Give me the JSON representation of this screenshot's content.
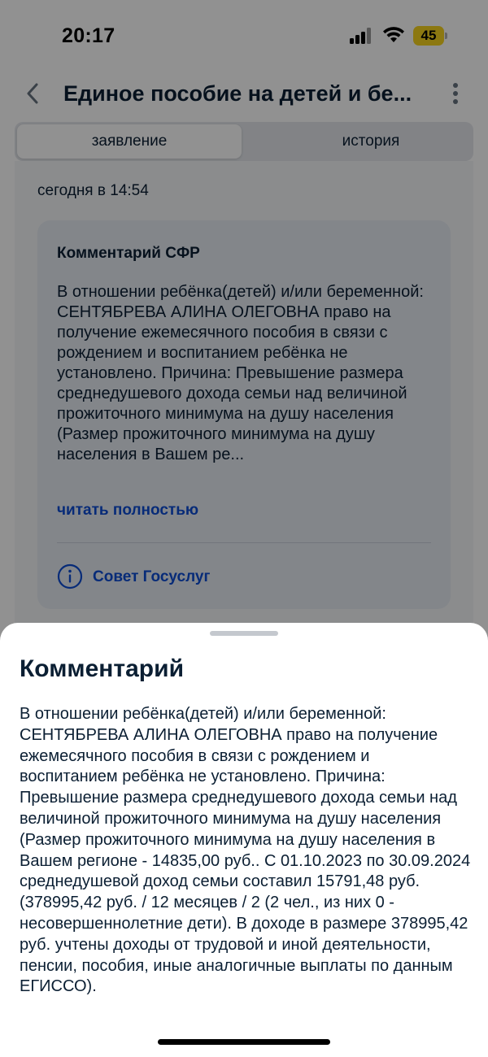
{
  "status_bar": {
    "time": "20:17",
    "battery_percent": "45",
    "battery_level": 0.45,
    "battery_color": "#f6d41e"
  },
  "nav": {
    "title": "Единое пособие на детей и бе...",
    "back_icon": "chevron-left-icon",
    "more_icon": "more-vertical-icon"
  },
  "tabs": [
    {
      "label": "заявление",
      "active": true
    },
    {
      "label": "история",
      "active": false
    }
  ],
  "main": {
    "date": "сегодня в 14:54",
    "card": {
      "title": "Комментарий СФР",
      "text": "В отношении ребёнка(детей) и/или беременной: СЕНТЯБРЕВА АЛИНА ОЛЕГОВНА право на получение ежемесячного пособия в связи с рождением и воспитанием ребёнка не установлено. Причина: Превышение размера среднедушевого дохода семьи над величиной прожиточного минимума на душу населения (Размер прожиточного минимума на душу населения в Вашем ре...",
      "read_more": "читать полностью",
      "tip_label": "Совет Госуслуг",
      "tip_icon": "info-icon"
    }
  },
  "sheet": {
    "title": "Комментарий",
    "text": "В отношении ребёнка(детей) и/или беременной: СЕНТЯБРЕВА АЛИНА ОЛЕГОВНА право на получение ежемесячного пособия в связи с рождением и воспитанием ребёнка не установлено. Причина: Превышение размера среднедушевого дохода семьи над величиной прожиточного минимума на душу населения (Размер прожиточного минимума на душу населения в Вашем регионе - 14835,00 руб.. С 01.10.2023 по 30.09.2024 среднедушевой доход семьи составил 15791,48 руб. (378995,42 руб. / 12 месяцев / 2 (2 чел., из них 0 - несовершеннолетние дети). В доходе в размере 378995,42 руб. учтены доходы от трудовой и иной деятельности, пенсии, пособия, иные аналогичные выплаты по данным ЕГИССО)."
  },
  "colors": {
    "link": "#0d4cd3",
    "text": "#0b1f33",
    "card_bg": "#e6ebf3"
  }
}
